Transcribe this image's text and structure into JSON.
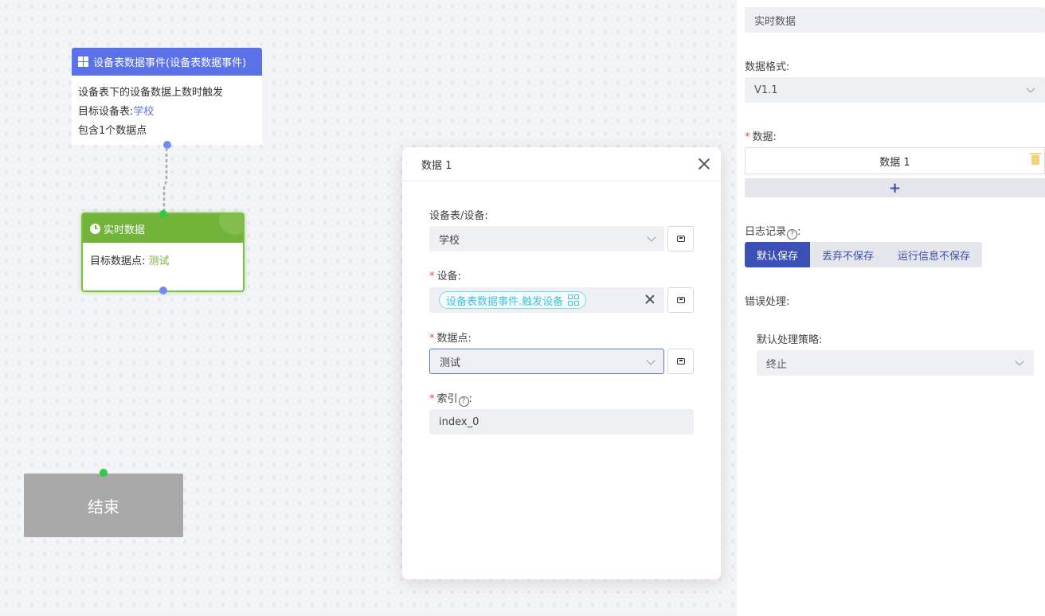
{
  "canvas": {
    "event_node": {
      "title": "设备表数据事件(设备表数据事件)",
      "line1": "设备表下的设备数据上数时触发",
      "line2_prefix": "目标设备表:",
      "line2_link": "学校",
      "line3": "包含1个数据点"
    },
    "realtime_node": {
      "title": "实时数据",
      "field_label": "目标数据点:",
      "field_value": "测试"
    },
    "end_node": {
      "label": "结束"
    }
  },
  "dialog": {
    "title": "数据 1",
    "device_table": {
      "label": "设备表/设备:",
      "value": "学校"
    },
    "device": {
      "label": "设备:",
      "tag": "设备表数据事件.触发设备"
    },
    "data_point": {
      "label": "数据点:",
      "value": "测试"
    },
    "index": {
      "label": "索引",
      "suffix": ":",
      "value": "index_0"
    }
  },
  "panel": {
    "name_value": "实时数据",
    "format": {
      "label": "数据格式:",
      "value": "V1.1"
    },
    "data": {
      "label": "数据:",
      "item": "数据 1",
      "add": "+"
    },
    "log": {
      "label": "日志记录",
      "suffix": ":",
      "options": [
        "默认保存",
        "丢弃不保存",
        "运行信息不保存"
      ],
      "selected": 0
    },
    "error": {
      "label": "错误处理:",
      "strategy_label": "默认处理策略:",
      "strategy_value": "终止"
    }
  },
  "colors": {
    "event_header": "#5b71e8",
    "realtime_header": "#72b33a",
    "primary": "#3b4fb6",
    "tag": "#49c0d6"
  }
}
